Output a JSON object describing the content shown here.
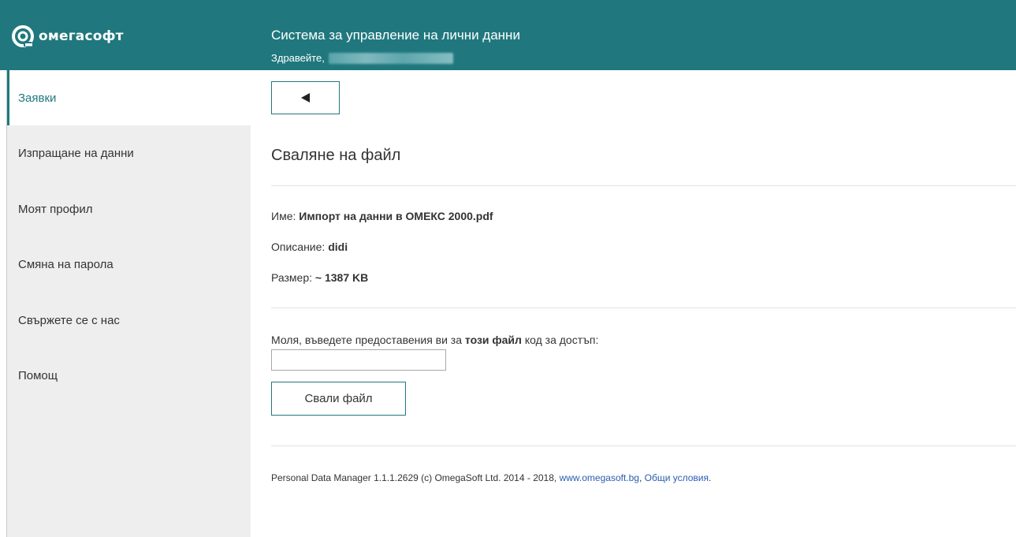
{
  "header": {
    "logo_text": "омегасофт",
    "title": "Система за управление на лични данни",
    "greeting_label": "Здравейте,",
    "brand_color": "#20787e"
  },
  "sidebar": {
    "items": [
      {
        "label": "Заявки",
        "active": true
      },
      {
        "label": "Изпращане на данни",
        "active": false
      },
      {
        "label": "Моят профил",
        "active": false
      },
      {
        "label": "Смяна на парола",
        "active": false
      },
      {
        "label": "Свържете се с нас",
        "active": false
      },
      {
        "label": "Помощ",
        "active": false
      }
    ]
  },
  "main": {
    "back_icon": "triangle-left-icon",
    "title": "Сваляне на файл",
    "file": {
      "name_label": "Име:",
      "name_value": "Импорт на данни в ОМЕКС 2000.pdf",
      "description_label": "Описание:",
      "description_value": "didi",
      "size_label": "Размер:",
      "size_value": "~ 1387 KB"
    },
    "code_prompt": {
      "before": "Моля, въведете предоставения ви за",
      "emphasis": "този файл",
      "after": "код за достъп:"
    },
    "code_input_value": "",
    "download_button": "Свали файл"
  },
  "footer": {
    "text": "Personal Data Manager 1.1.1.2629 (c) OmegaSoft Ltd. 2014 - 2018,",
    "website_link": "www.omegasoft.bg",
    "terms_link": "Общи условия",
    "link_color": "#2a5db0"
  }
}
